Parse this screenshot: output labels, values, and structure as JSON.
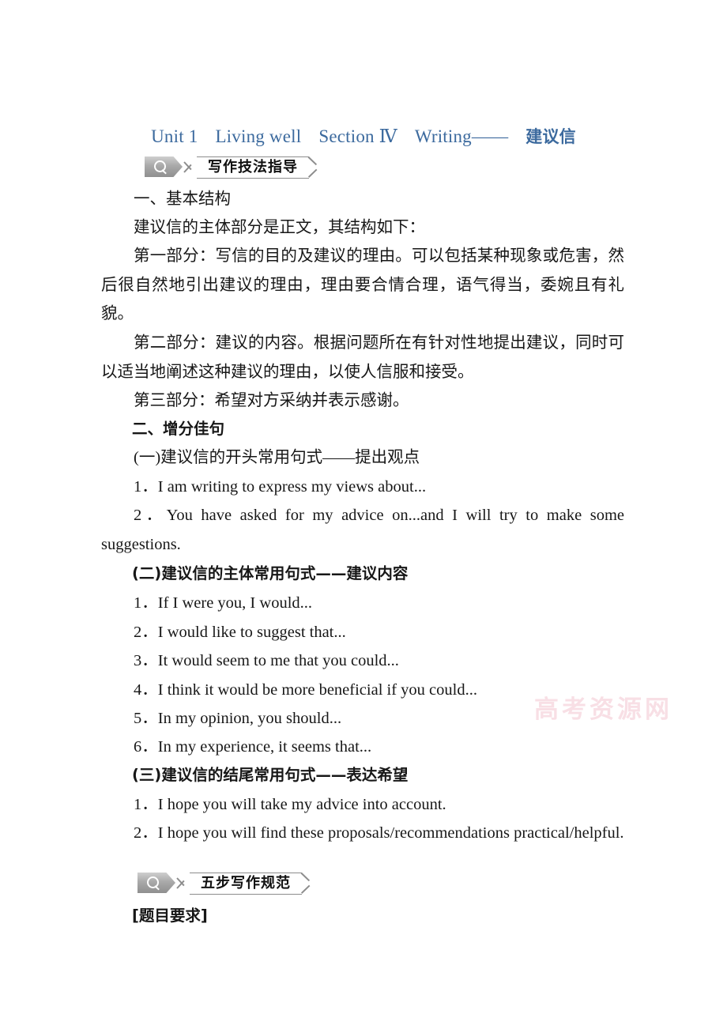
{
  "title": {
    "unit": "Unit 1",
    "lesson": "Living well",
    "section": "Section Ⅳ",
    "topic_en": "Writing——",
    "topic_cn": "建议信",
    "color": "#3c6a9e"
  },
  "banners": [
    {
      "icon": "magnifier-icon",
      "label": "写作技法指导"
    },
    {
      "icon": "magnifier-icon",
      "label": "五步写作规范"
    }
  ],
  "sections": {
    "structure": {
      "heading": "一、基本结构",
      "intro": "建议信的主体部分是正文，其结构如下：",
      "parts": [
        "第一部分：写信的目的及建议的理由。可以包括某种现象或危害，然后很自然地引出建议的理由，理由要合情合理，语气得当，委婉且有礼貌。",
        "第二部分：建议的内容。根据问题所在有针对性地提出建议，同时可以适当地阐述这种建议的理由，以使人信服和接受。",
        "第三部分：希望对方采纳并表示感谢。"
      ]
    },
    "sentences": {
      "heading": "二、增分佳句",
      "groups": [
        {
          "heading": "(一)建议信的开头常用句式——提出观点",
          "bold": false,
          "items": [
            {
              "num": "1．",
              "text": "I am writing to express my views about..."
            },
            {
              "num": "2．",
              "text": "You have asked for my advice on...and I will try to make some suggestions."
            }
          ]
        },
        {
          "heading": "(二)建议信的主体常用句式——建议内容",
          "bold": true,
          "items": [
            {
              "num": "1．",
              "text": "If I were you, I would..."
            },
            {
              "num": "2．",
              "text": "I would like to suggest that..."
            },
            {
              "num": "3．",
              "text": "It would seem to me that you could..."
            },
            {
              "num": "4．",
              "text": "I think it would be more beneficial if you could..."
            },
            {
              "num": "5．",
              "text": "In my opinion, you should..."
            },
            {
              "num": "6．",
              "text": "In my experience, it seems that..."
            }
          ]
        },
        {
          "heading": "(三)建议信的结尾常用句式——表达希望",
          "bold": true,
          "items": [
            {
              "num": "1．",
              "text": "I hope you will take my advice into account."
            },
            {
              "num": "2．",
              "text": "I hope you will find these proposals/recommendations practical/helpful."
            }
          ]
        }
      ]
    },
    "requirement_label": "[题目要求]"
  },
  "watermark": "高考资源网"
}
